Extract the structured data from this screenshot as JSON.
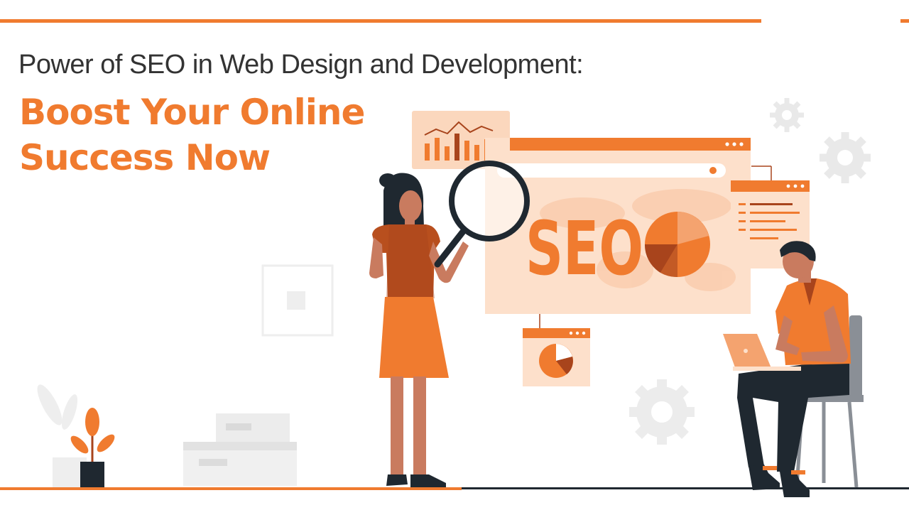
{
  "banner": {
    "headline": "Power of SEO in Web Design and Development:",
    "subheadline_line1": "Boost Your Online",
    "subheadline_line2": "Success Now"
  },
  "illustration": {
    "seo_text": "SEO",
    "icons": [
      "bar-chart-icon",
      "magnifying-glass-icon",
      "pie-chart-icon",
      "gear-icon",
      "plant-icon",
      "laptop-icon",
      "chair-icon"
    ]
  },
  "colors": {
    "accent": "#f07b2f",
    "accent_dark": "#a8441c",
    "accent_light": "#fcd9c0",
    "text_dark": "#333333",
    "figure_dark": "#1f2830",
    "skin": "#c97b5f",
    "neutral_gray": "#e6e6e6"
  }
}
